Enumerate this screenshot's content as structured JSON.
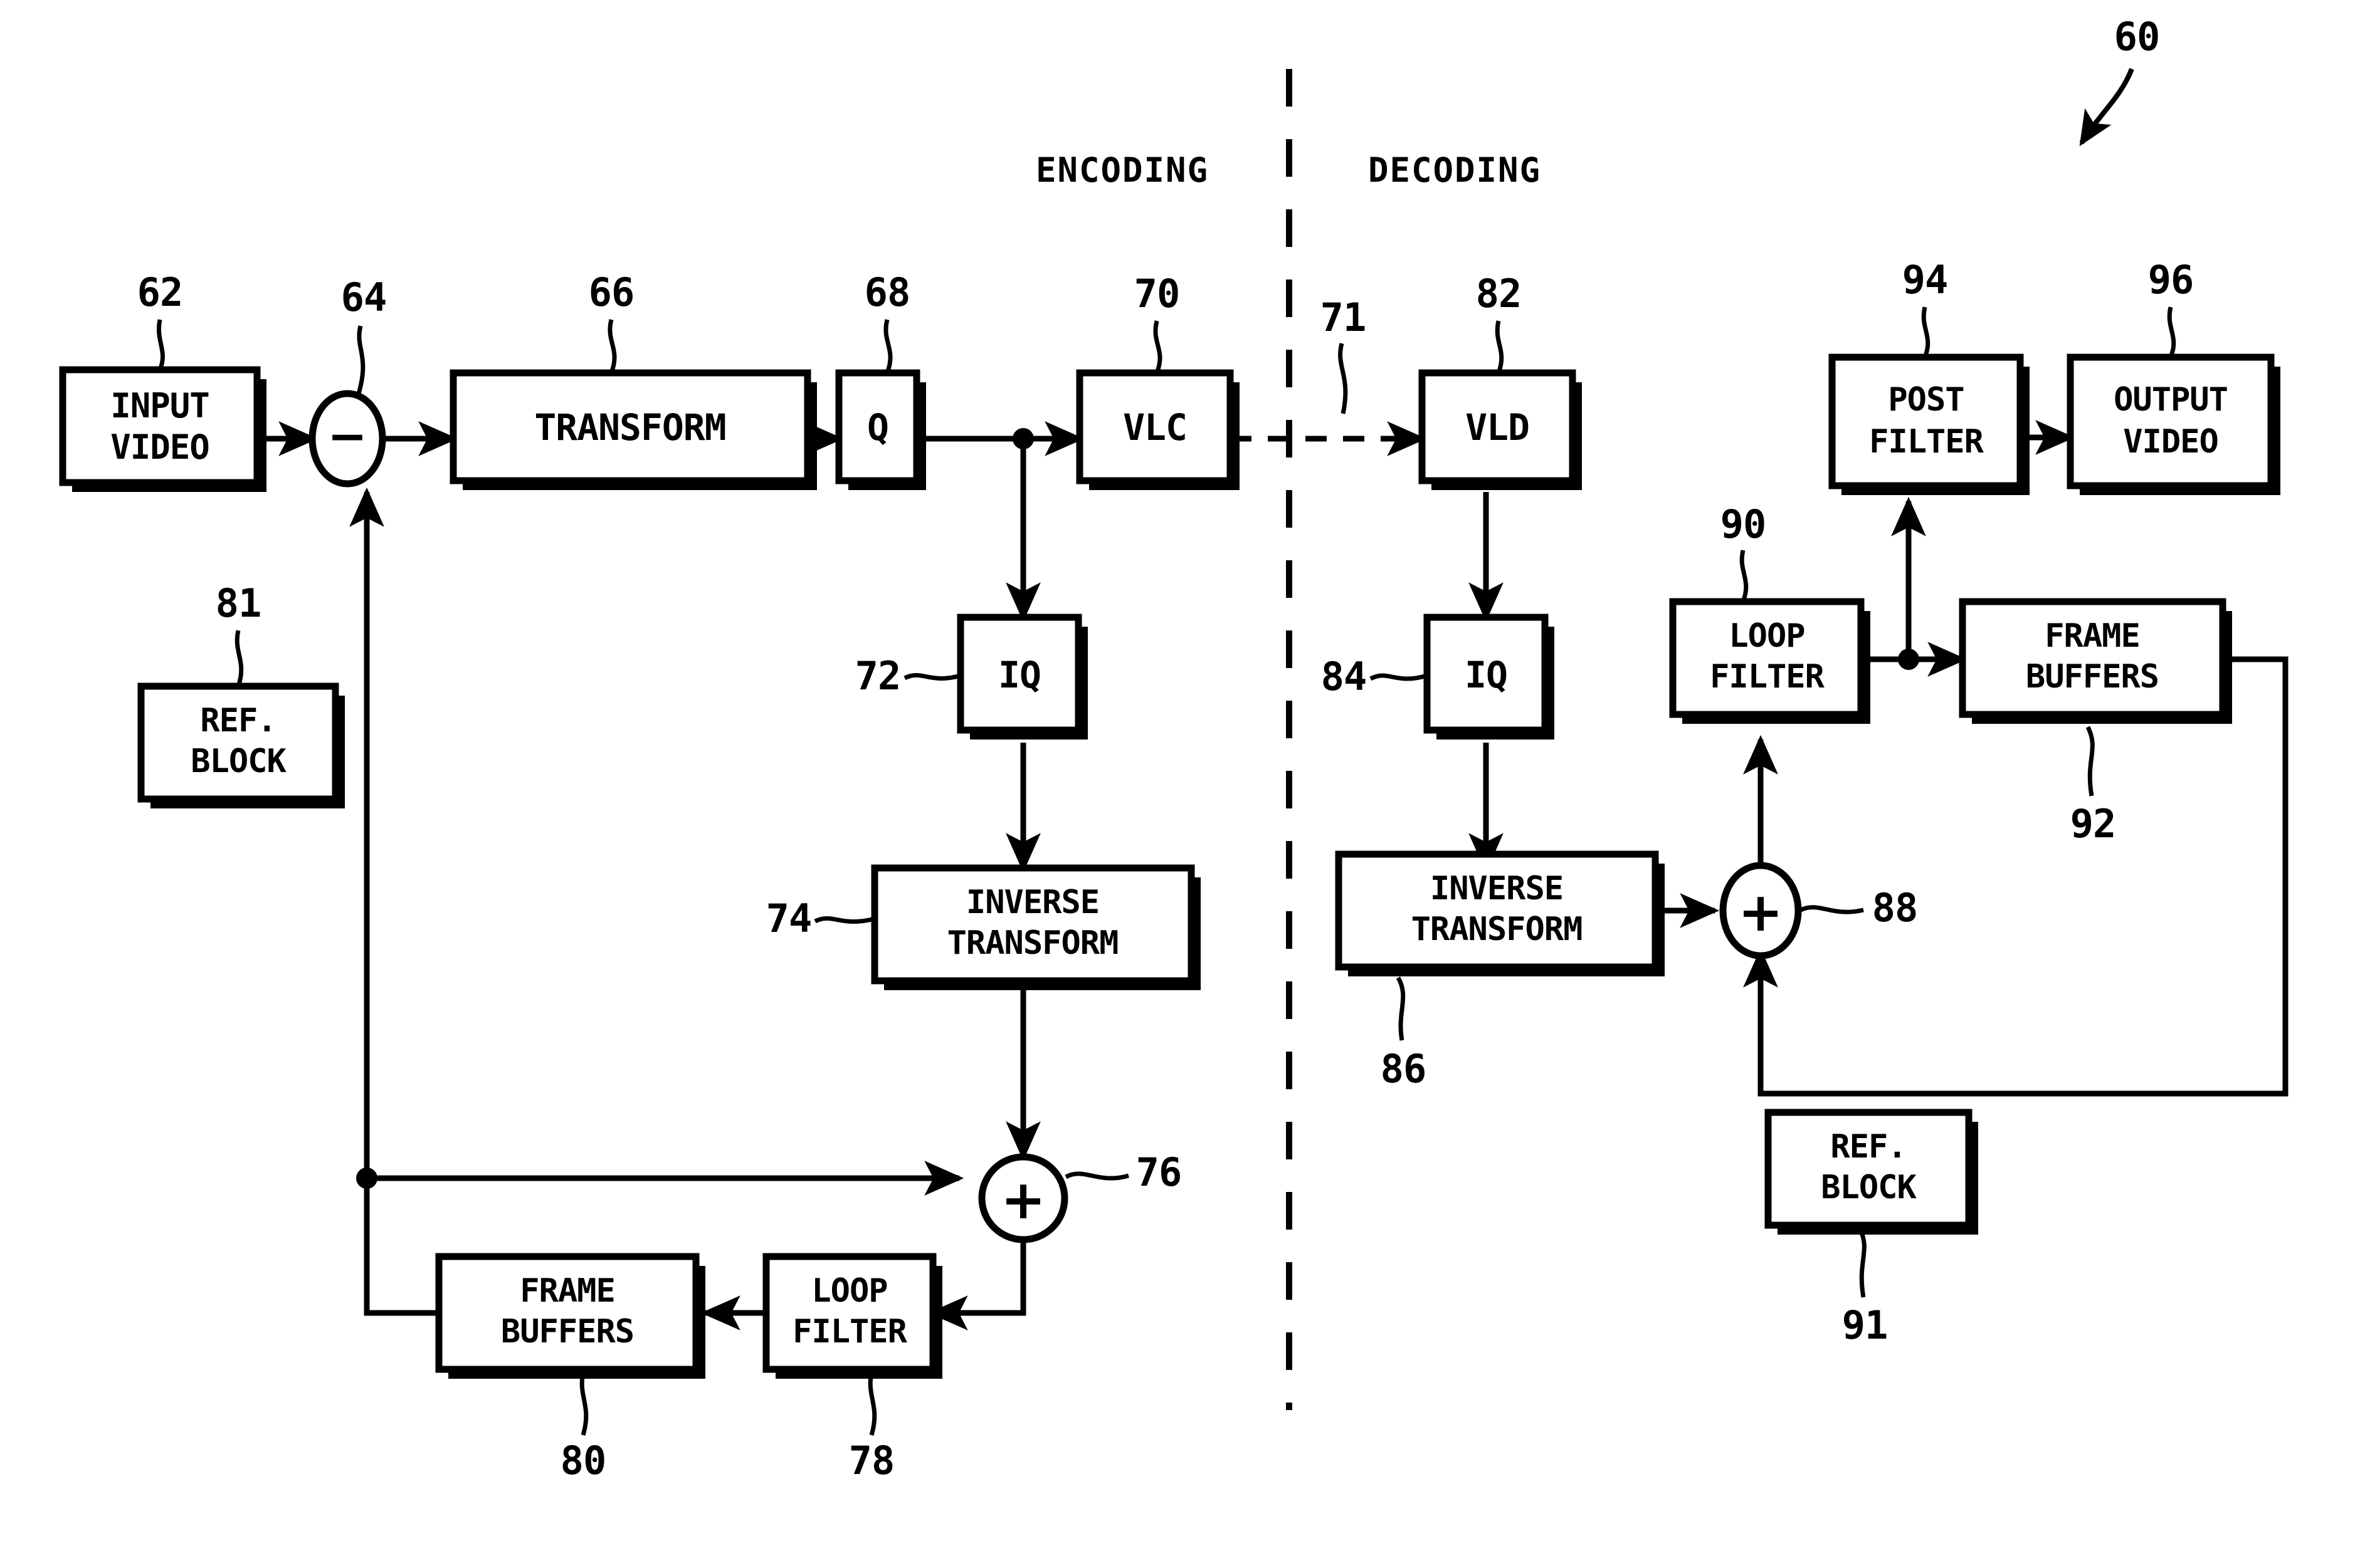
{
  "figure": {
    "figure_ref": "60",
    "section_labels": {
      "left": "ENCODING",
      "right": "DECODING"
    },
    "divider_ref": "71"
  },
  "blocks": [
    {
      "id": "input_video",
      "label_line1": "INPUT",
      "label_line2": "VIDEO",
      "ref": "62"
    },
    {
      "id": "transform",
      "label_line1": "TRANSFORM",
      "label_line2": "",
      "ref": "66"
    },
    {
      "id": "q",
      "label_line1": "Q",
      "label_line2": "",
      "ref": "68"
    },
    {
      "id": "vlc",
      "label_line1": "VLC",
      "label_line2": "",
      "ref": "70"
    },
    {
      "id": "iq_enc",
      "label_line1": "IQ",
      "label_line2": "",
      "ref": "72"
    },
    {
      "id": "inverse_transform_enc",
      "label_line1": "INVERSE",
      "label_line2": "TRANSFORM",
      "ref": "74"
    },
    {
      "id": "loop_filter_enc",
      "label_line1": "LOOP",
      "label_line2": "FILTER",
      "ref": "78"
    },
    {
      "id": "frame_buffers_enc",
      "label_line1": "FRAME",
      "label_line2": "BUFFERS",
      "ref": "80"
    },
    {
      "id": "ref_block_enc",
      "label_line1": "REF.",
      "label_line2": "BLOCK",
      "ref": "81"
    },
    {
      "id": "vld",
      "label_line1": "VLD",
      "label_line2": "",
      "ref": "82"
    },
    {
      "id": "iq_dec",
      "label_line1": "IQ",
      "label_line2": "",
      "ref": "84"
    },
    {
      "id": "inverse_transform_dec",
      "label_line1": "INVERSE",
      "label_line2": "TRANSFORM",
      "ref": "86"
    },
    {
      "id": "loop_filter_dec",
      "label_line1": "LOOP",
      "label_line2": "FILTER",
      "ref": "90"
    },
    {
      "id": "frame_buffers_dec",
      "label_line1": "FRAME",
      "label_line2": "BUFFERS",
      "ref": "92"
    },
    {
      "id": "ref_block_dec",
      "label_line1": "REF.",
      "label_line2": "BLOCK",
      "ref": "91"
    },
    {
      "id": "post_filter",
      "label_line1": "POST",
      "label_line2": "FILTER",
      "ref": "94"
    },
    {
      "id": "output_video",
      "label_line1": "OUTPUT",
      "label_line2": "VIDEO",
      "ref": "96"
    }
  ],
  "operators": [
    {
      "id": "subtractor",
      "symbol": "−",
      "ref": "64"
    },
    {
      "id": "adder_enc",
      "symbol": "+",
      "ref": "76"
    },
    {
      "id": "adder_dec",
      "symbol": "+",
      "ref": "88"
    }
  ],
  "text": {
    "b_input_video_1": "INPUT",
    "b_input_video_2": "VIDEO",
    "b_transform": "TRANSFORM",
    "b_q": "Q",
    "b_vlc": "VLC",
    "b_iq_enc": "IQ",
    "b_invt_enc_1": "INVERSE",
    "b_invt_enc_2": "TRANSFORM",
    "b_lf_enc_1": "LOOP",
    "b_lf_enc_2": "FILTER",
    "b_fb_enc_1": "FRAME",
    "b_fb_enc_2": "BUFFERS",
    "b_rb_enc_1": "REF.",
    "b_rb_enc_2": "BLOCK",
    "b_vld": "VLD",
    "b_iq_dec": "IQ",
    "b_invt_dec_1": "INVERSE",
    "b_invt_dec_2": "TRANSFORM",
    "b_lf_dec_1": "LOOP",
    "b_lf_dec_2": "FILTER",
    "b_fb_dec_1": "FRAME",
    "b_fb_dec_2": "BUFFERS",
    "b_rb_dec_1": "REF.",
    "b_rb_dec_2": "BLOCK",
    "b_pf_1": "POST",
    "b_pf_2": "FILTER",
    "b_ov_1": "OUTPUT",
    "b_ov_2": "VIDEO",
    "lbl_encoding": "ENCODING",
    "lbl_decoding": "DECODING",
    "n60": "60",
    "n62": "62",
    "n64": "64",
    "n66": "66",
    "n68": "68",
    "n70": "70",
    "n71": "71",
    "n72": "72",
    "n74": "74",
    "n76": "76",
    "n78": "78",
    "n80": "80",
    "n81": "81",
    "n82": "82",
    "n84": "84",
    "n86": "86",
    "n88": "88",
    "n90": "90",
    "n91": "91",
    "n92": "92",
    "n94": "94",
    "n96": "96",
    "sym_minus": "−",
    "sym_plus_enc": "+",
    "sym_plus_dec": "+"
  },
  "colors": {
    "ink": "#000000",
    "paper": "#ffffff"
  }
}
